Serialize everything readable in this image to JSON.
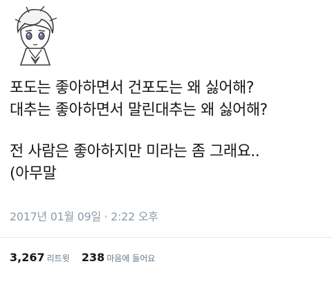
{
  "tweet": {
    "lines": [
      "포도는 좋아하면서 건포도는 왜 싫어해?",
      "대추는 좋아하면서 말린대추는 왜 싫어해?",
      "전 사람은 좋아하지만 미라는 좀 그래요..",
      "(아무말"
    ],
    "timestamp": "2017년 01월 09일 · 2:22 오후"
  },
  "stats": {
    "retweets_count": "3,267",
    "retweets_label": "리트윗",
    "likes_count": "238",
    "likes_label": "마음에 들어요"
  },
  "colors": {
    "text": "#14171a",
    "muted": "#8c9aa6",
    "divider": "#e1e8ed"
  },
  "avatar": {
    "icon": "anime-character-avatar"
  }
}
